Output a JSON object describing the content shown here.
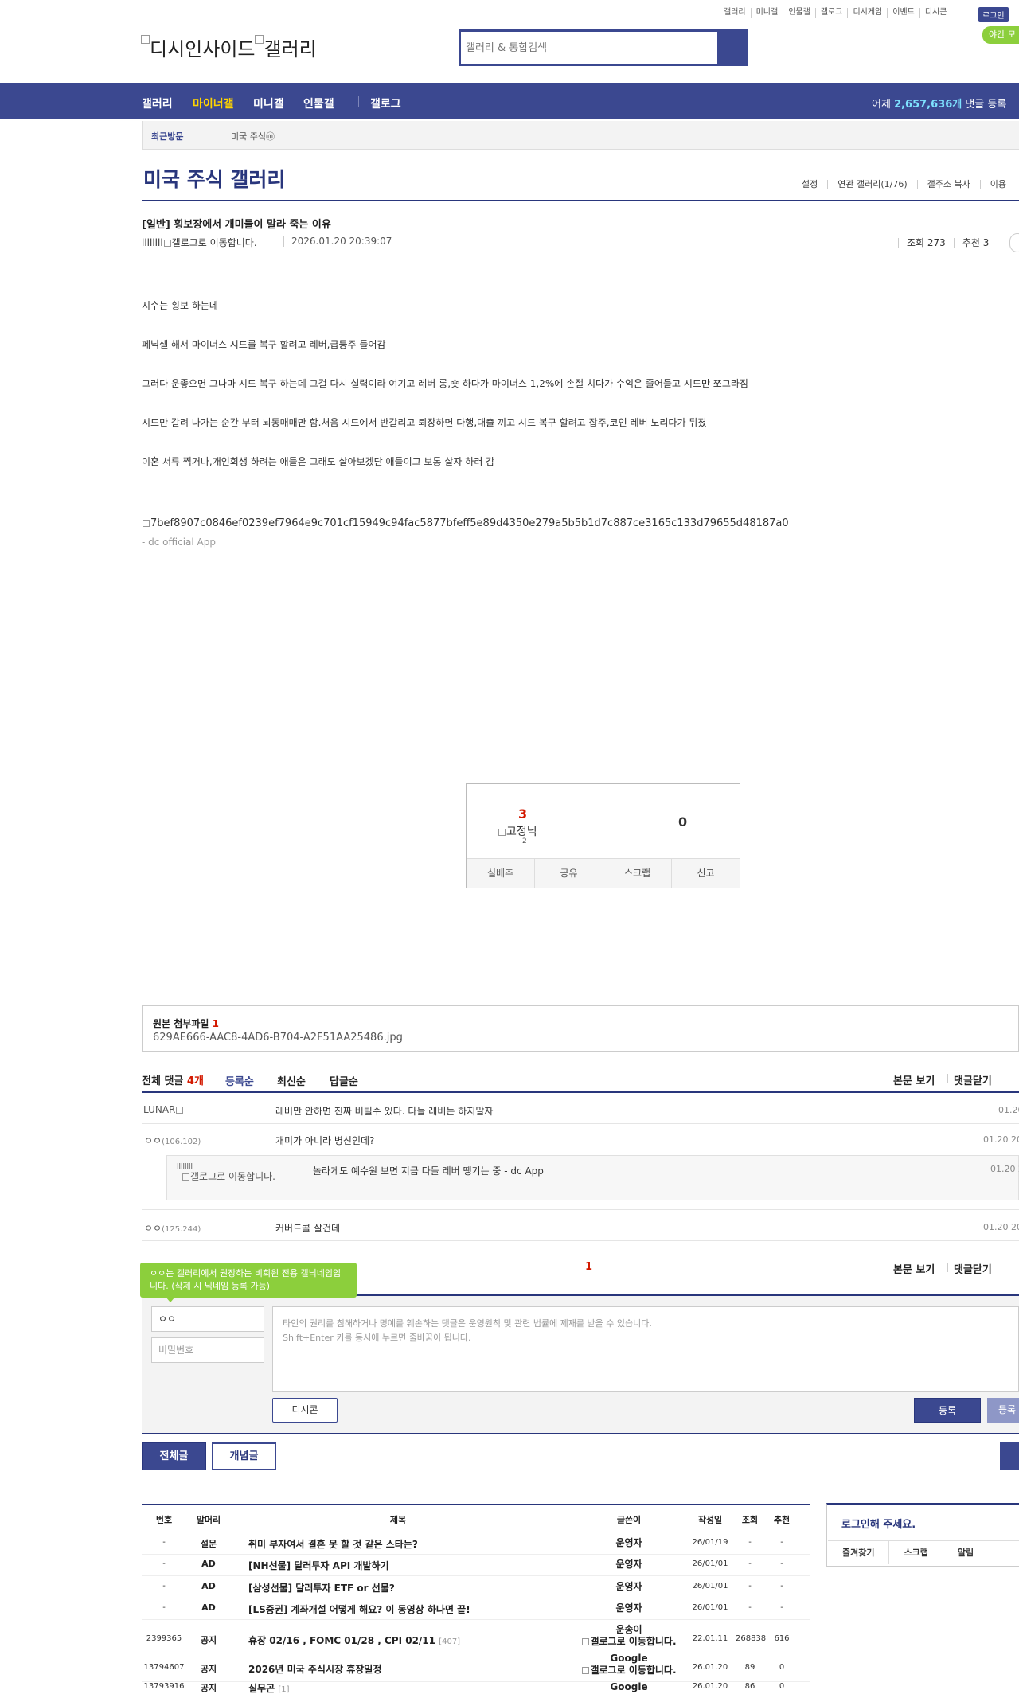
{
  "top_links": [
    "갤러리",
    "미니갤",
    "인물갤",
    "갤로그",
    "디시게임",
    "이벤트",
    "디시콘"
  ],
  "login_label": "로그인",
  "night_label": "야간 모",
  "logo": {
    "left_alt": "디시인사이드",
    "right_alt": "갤러리"
  },
  "search": {
    "placeholder": "갤러리 & 통합검색"
  },
  "nav": {
    "items": [
      "갤러리",
      "마이너갤",
      "미니갤",
      "인물갤",
      "갤로그"
    ],
    "active": "마이너갤",
    "stat_prefix": "어제 ",
    "stat_value": "2,657,636개",
    "stat_suffix": " 댓글 등록"
  },
  "recent": {
    "label": "최근방문",
    "item": "미국 주식ⓜ"
  },
  "gallery": {
    "title": "미국 주식 갤러리",
    "menu": [
      "설정",
      "연관 갤러리(1/76)",
      "갤주소 복사",
      "이용"
    ]
  },
  "post": {
    "title": "[일반] 횡보장에서 개미들이 말라 죽는 이유",
    "writer": "llllllll",
    "writer_alt": "갤로그로 이동합니다.",
    "date": "2026.01.20 20:39:07",
    "views": "조회 273",
    "recommend": "추천 3",
    "body": [
      "지수는 횡보 하는데",
      "페닉셀 해서 마이너스 시드를 복구 할려고 레버,급등주 들어감",
      "그러다 운좋으면 그나마 시드 복구 하는데 그걸 다시 실력이라 여기고 레버 롱,숏 하다가 마이너스 1,2%에 손절 치다가 수익은 줄어들고 시드만 쪼그라짐",
      "시드만 갈려 나가는 순간 부터 뇌동매매만 함.처음 시드에서 반갈리고 퇴장하면 다행,대출 끼고 시드 복구 할려고 잡주,코인 레버 노리다가 뒤졌",
      "이혼 서류 찍거나,개인회생 하려는 애들은 그래도 살아보겠단 애들이고 보통 살자 하러 감"
    ],
    "image_alt": "7bef8907c0846ef0239ef7964e9c701cf15949c94fac5877bfeff5e89d4350e279a5b5b1d7c887ce3165c133d79655d48187a0",
    "app_sig": "- dc official App"
  },
  "recommend_box": {
    "up": "3",
    "fix_alt": "고정닉",
    "fix_count": "2",
    "down": "0",
    "actions": [
      "실베추",
      "공유",
      "스크랩",
      "신고"
    ]
  },
  "attachment": {
    "title_prefix": "원본 첨부파일 ",
    "count": "1",
    "file": "629AE666-AAC8-4AD6-B704-A2F51AA25486.jpg"
  },
  "comments": {
    "header_prefix": "전체 댓글 ",
    "count": "4개",
    "sort": [
      "등록순",
      "최신순",
      "답글순"
    ],
    "right_links": [
      "본문 보기",
      "댓글닫기"
    ],
    "items": [
      {
        "nick": "LUNAR",
        "ip": "",
        "text": "레버만 안하면 진짜 버틸수 있다. 다들 레버는 하지말자",
        "date": "01.20"
      },
      {
        "nick": "ㅇㅇ",
        "ip": "(106.102)",
        "text": "개미가 아니라 병신인데?",
        "date": "01.20 20"
      },
      {
        "nick": "llllllll",
        "ip": "",
        "nick_alt": "갤로그로 이동합니다.",
        "text": "놀라게도 예수원 보면 지금 다들 레버 땡기는 중 - dc App",
        "date": "01.20 2"
      },
      {
        "nick": "ㅇㅇ",
        "ip": "(125.244)",
        "text": "커버드콜 살건데",
        "date": "01.20 20"
      }
    ],
    "page": "1"
  },
  "write": {
    "tip": "ㅇㅇ는 갤러리에서 권장하는 비회원 전용 갤닉네임입니다. (삭제 시 닉네임 등록 가능)",
    "name_value": "ㅇㅇ",
    "pw_placeholder": "비밀번호",
    "memo_placeholder_1": "타인의 권리를 침해하거나 명예를 훼손하는 댓글은 운영원칙 및 관련 법률에 제재를 받을 수 있습니다.",
    "memo_placeholder_2": "Shift+Enter 키를 동시에 누르면 줄바꿈이 됩니다.",
    "dccon": "디시콘",
    "submit": "등록",
    "submit2": "등록"
  },
  "tabs": [
    "전체글",
    "개념글"
  ],
  "list": {
    "headers": [
      "번호",
      "말머리",
      "제목",
      "글쓴이",
      "작성일",
      "조회",
      "추천"
    ],
    "rows": [
      {
        "num": "-",
        "sub": "설문",
        "title": "취미 부자여서 결혼 못 할 것 같은 스타는?",
        "reply": "",
        "writer": "운영자",
        "writer2": "",
        "date": "26/01/19",
        "views": "-",
        "rec": "-"
      },
      {
        "num": "-",
        "sub": "AD",
        "title": "[NH선물] 달러투자 API 개발하기",
        "reply": "",
        "writer": "운영자",
        "writer2": "",
        "date": "26/01/01",
        "views": "-",
        "rec": "-"
      },
      {
        "num": "-",
        "sub": "AD",
        "title": "[삼성선물] 달러투자 ETF or 선물?",
        "reply": "",
        "writer": "운영자",
        "writer2": "",
        "date": "26/01/01",
        "views": "-",
        "rec": "-"
      },
      {
        "num": "-",
        "sub": "AD",
        "title": "[LS증권] 계좌개설 어떻게 해요? 이 동영상 하나면 끝!",
        "reply": "",
        "writer": "운영자",
        "writer2": "",
        "date": "26/01/01",
        "views": "-",
        "rec": "-"
      },
      {
        "num": "2399365",
        "sub": "공지",
        "title": "휴장 02/16 , FOMC 01/28 , CPI 02/11",
        "reply": "[407]",
        "writer": "운송이",
        "writer2": "갤로그로 이동합니다.",
        "date": "22.01.11",
        "views": "268838",
        "rec": "616"
      },
      {
        "num": "13794607",
        "sub": "공지",
        "title": "2026년 미국 주식시장 휴장일정",
        "reply": "",
        "writer": "Google",
        "writer2": "갤로그로 이동합니다.",
        "date": "26.01.20",
        "views": "89",
        "rec": "0"
      },
      {
        "num": "13793916",
        "sub": "공지",
        "title": "실무곤",
        "reply": "[1]",
        "writer": "Google",
        "writer2": "",
        "date": "26.01.20",
        "views": "86",
        "rec": "0"
      }
    ]
  },
  "login_panel": {
    "message": "로그인해 주세요.",
    "links": [
      "즐겨찾기",
      "스크랩",
      "알림"
    ]
  },
  "colors": {
    "brand": "#3b4890",
    "brand_dark": "#29367c",
    "accent_yellow": "#ffd400",
    "accent_green": "#8ccf3c",
    "red": "#d31900"
  }
}
